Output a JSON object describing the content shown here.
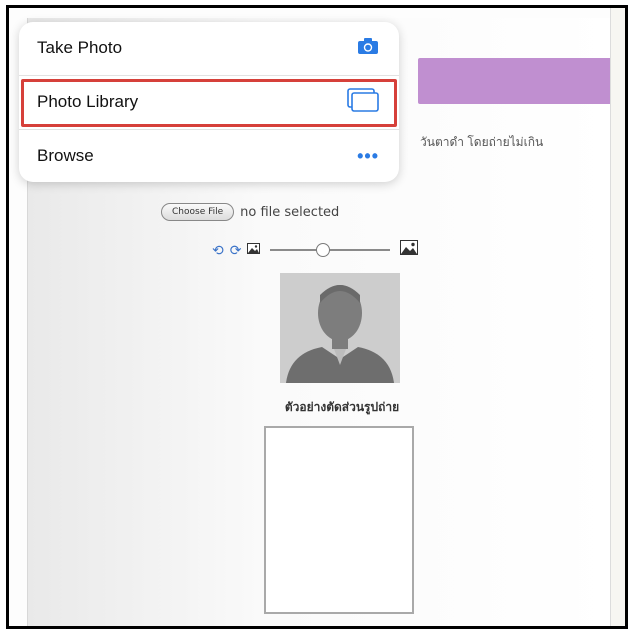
{
  "menu": {
    "take_photo": "Take Photo",
    "photo_library": "Photo Library",
    "browse": "Browse",
    "icons": {
      "take_photo": "camera-icon",
      "photo_library": "photo-library-icon",
      "browse": "more-dots-icon"
    },
    "highlighted_item": "Photo Library",
    "highlight_color": "#d6403a",
    "accent_color": "#2a7be4"
  },
  "form": {
    "note_text": "วันตาดำ โดยถ่ายไม่เกิน",
    "choose_file_label": "Choose File",
    "file_status": "no file selected",
    "crop_caption": "ตัวอย่างตัดส่วนรูปถ่าย",
    "banner_color": "#c08fd0"
  },
  "toolbar": {
    "icons": [
      "rotate-left-icon",
      "rotate-right-icon",
      "image-small-icon",
      "zoom-slider",
      "image-large-icon"
    ],
    "zoom_level": 0.43
  }
}
